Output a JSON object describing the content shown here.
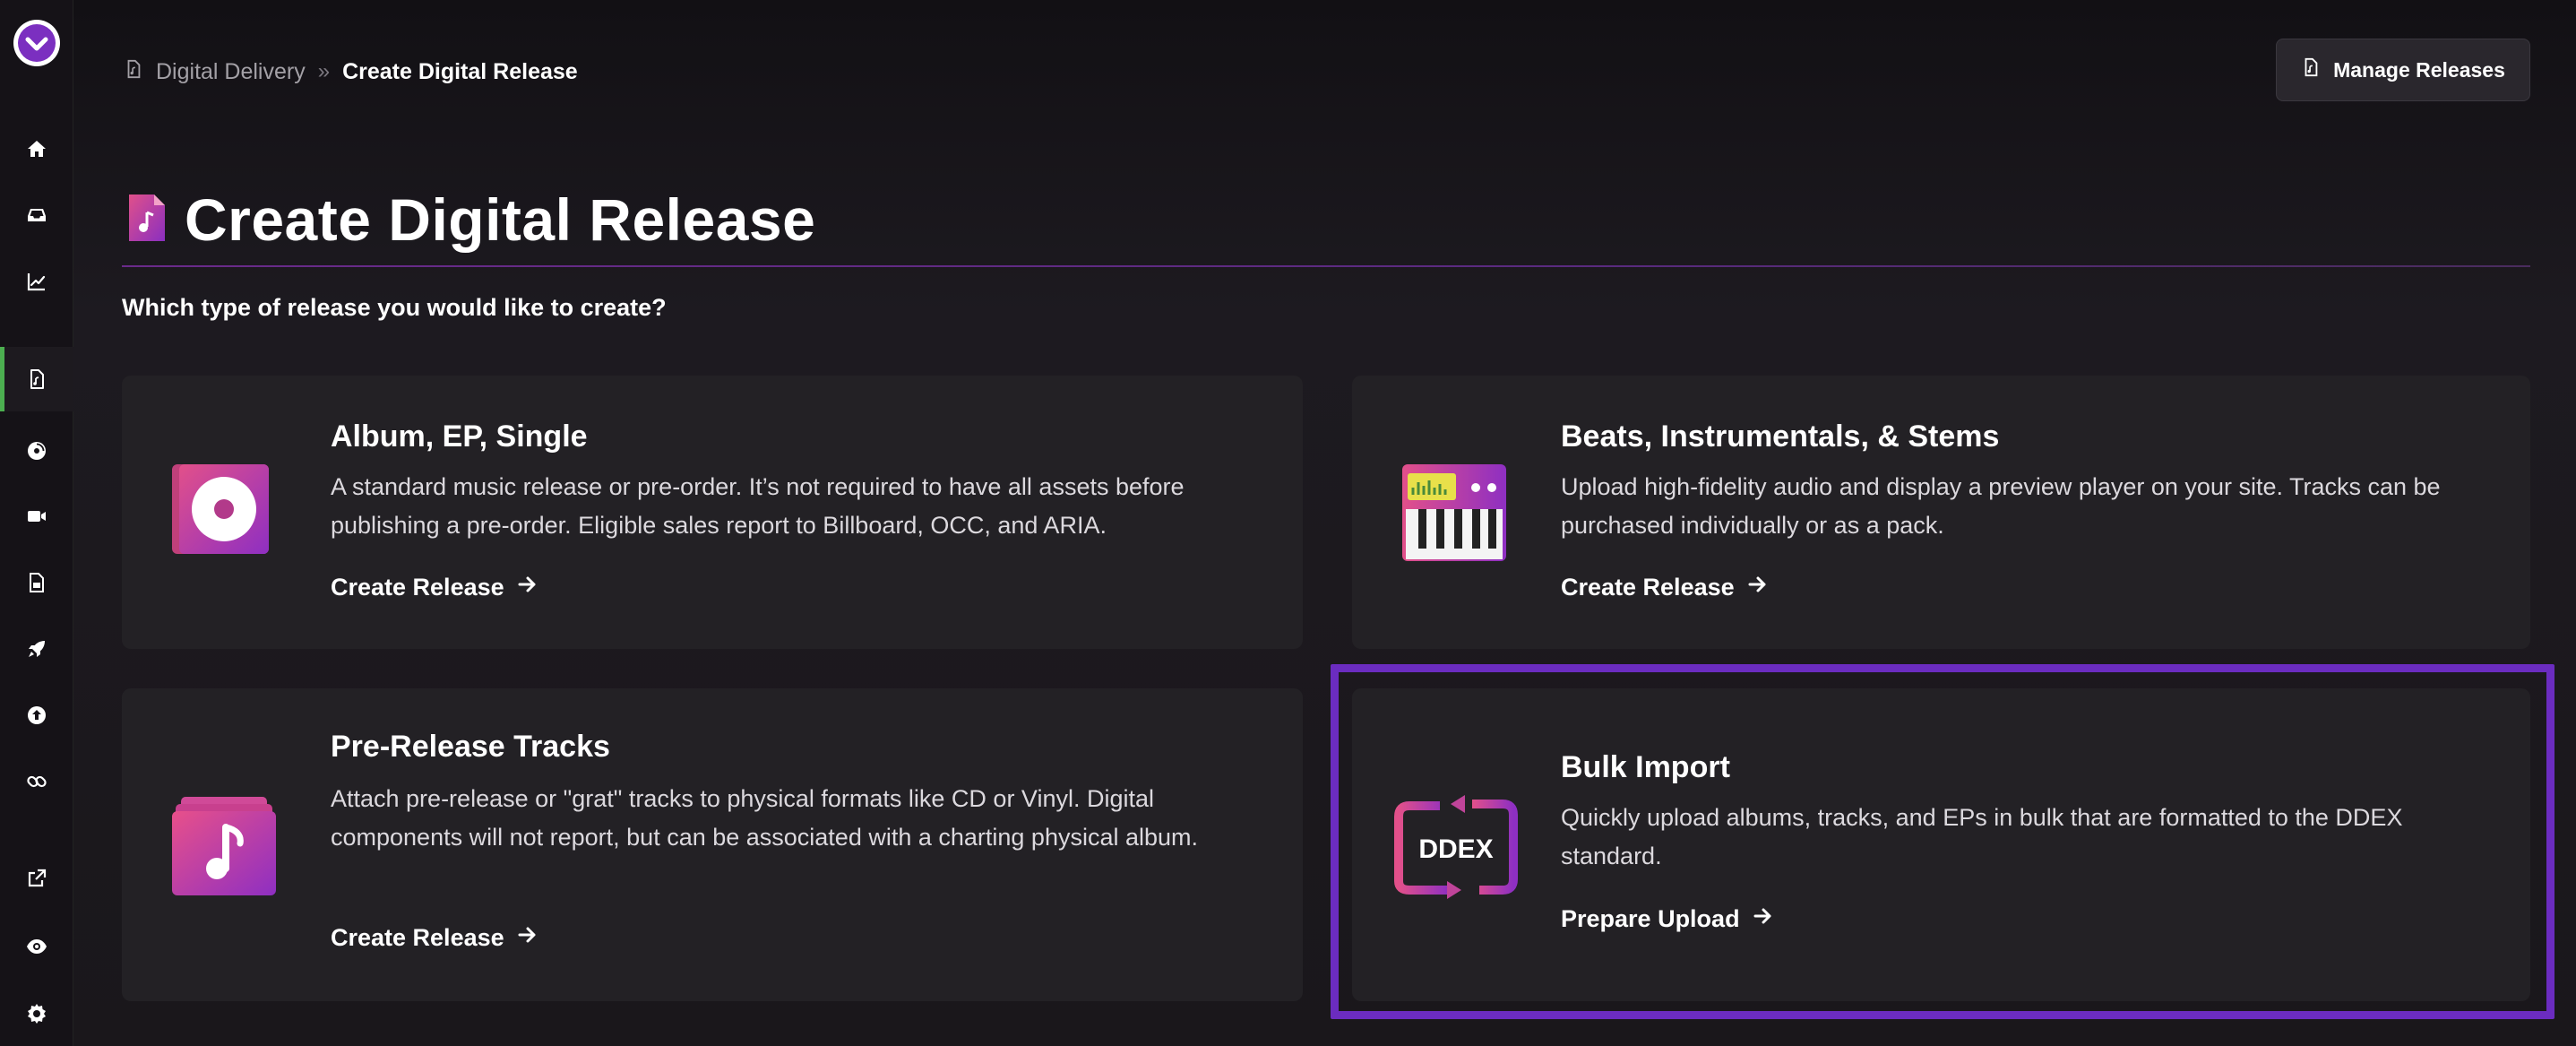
{
  "breadcrumb": {
    "parent": "Digital Delivery",
    "current": "Create Digital Release"
  },
  "header": {
    "manage_button": "Manage Releases"
  },
  "page": {
    "title": "Create Digital Release",
    "subtitle": "Which type of release you would like to create?"
  },
  "cards": [
    {
      "title": "Album, EP, Single",
      "description": "A standard music release or pre-order. It’s not required to have all assets before publishing a pre-order. Eligible sales report to Billboard, OCC, and ARIA.",
      "action": "Create Release",
      "icon": "vinyl-album-icon"
    },
    {
      "title": "Beats, Instrumentals, & Stems",
      "description": "Upload high-fidelity audio and display a preview player on your site. Tracks can be purchased individually or as a pack.",
      "action": "Create Release",
      "icon": "keyboard-synth-icon"
    },
    {
      "title": "Pre-Release Tracks",
      "description": "Attach pre-release or \"grat\" tracks to physical formats like CD or Vinyl. Digital components will not report, but can be associated with a charting physical album.",
      "action": "Create Release",
      "icon": "music-note-stack-icon"
    },
    {
      "title": "Bulk Import",
      "description": "Quickly upload albums, tracks, and EPs in bulk that are formatted to the DDEX standard.",
      "action": "Prepare Upload",
      "icon": "ddex-sync-icon",
      "icon_text": "DDEX"
    }
  ],
  "sidebar": {
    "items": [
      "home-icon",
      "inbox-icon",
      "chart-line-icon",
      "file-audio-icon",
      "compact-disc-icon",
      "video-icon",
      "ticket-icon",
      "rocket-icon",
      "upload-icon",
      "link-icon",
      "external-link-icon",
      "eye-icon",
      "gear-icon"
    ],
    "active": "file-audio-icon"
  },
  "colors": {
    "accent_purple": "#6b2cc0",
    "active_indicator": "#4caf50",
    "card_bg": "#232125",
    "page_bg": "#1a171c"
  }
}
